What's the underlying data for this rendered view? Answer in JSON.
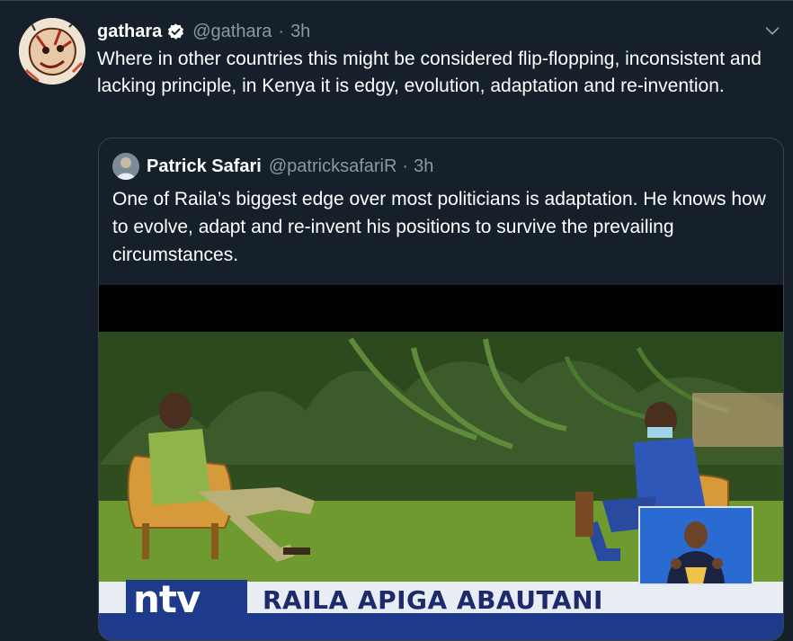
{
  "tweet": {
    "display_name": "gathara",
    "handle": "@gathara",
    "separator": "·",
    "time": "3h",
    "text": "Where in other countries this might be considered flip-flopping, inconsistent and lacking principle, in Kenya it is edgy, evolution, adaptation and re-invention.",
    "verified": true
  },
  "quoted_tweet": {
    "display_name": "Patrick Safari",
    "handle": "@patricksafariR",
    "separator": "·",
    "time": "3h",
    "text": "One of Raila’s biggest edge over most politicians is adaptation. He knows how to evolve, adapt and re-invent his positions to survive the prevailing circumstances.",
    "media": {
      "channel_logo": "ntv",
      "headline": "RAILA APIGA ABAUTANI"
    }
  },
  "colors": {
    "background": "#15202b",
    "border": "#38444d",
    "secondary_text": "#8899a6",
    "primary_text": "#ffffff",
    "verified_badge": "#ffffff",
    "ticker_bar": "#e8ecf3",
    "ticker_text": "#1d2a6b"
  },
  "icons": {
    "verified": "verified-badge-icon",
    "caret": "chevron-down-icon"
  }
}
